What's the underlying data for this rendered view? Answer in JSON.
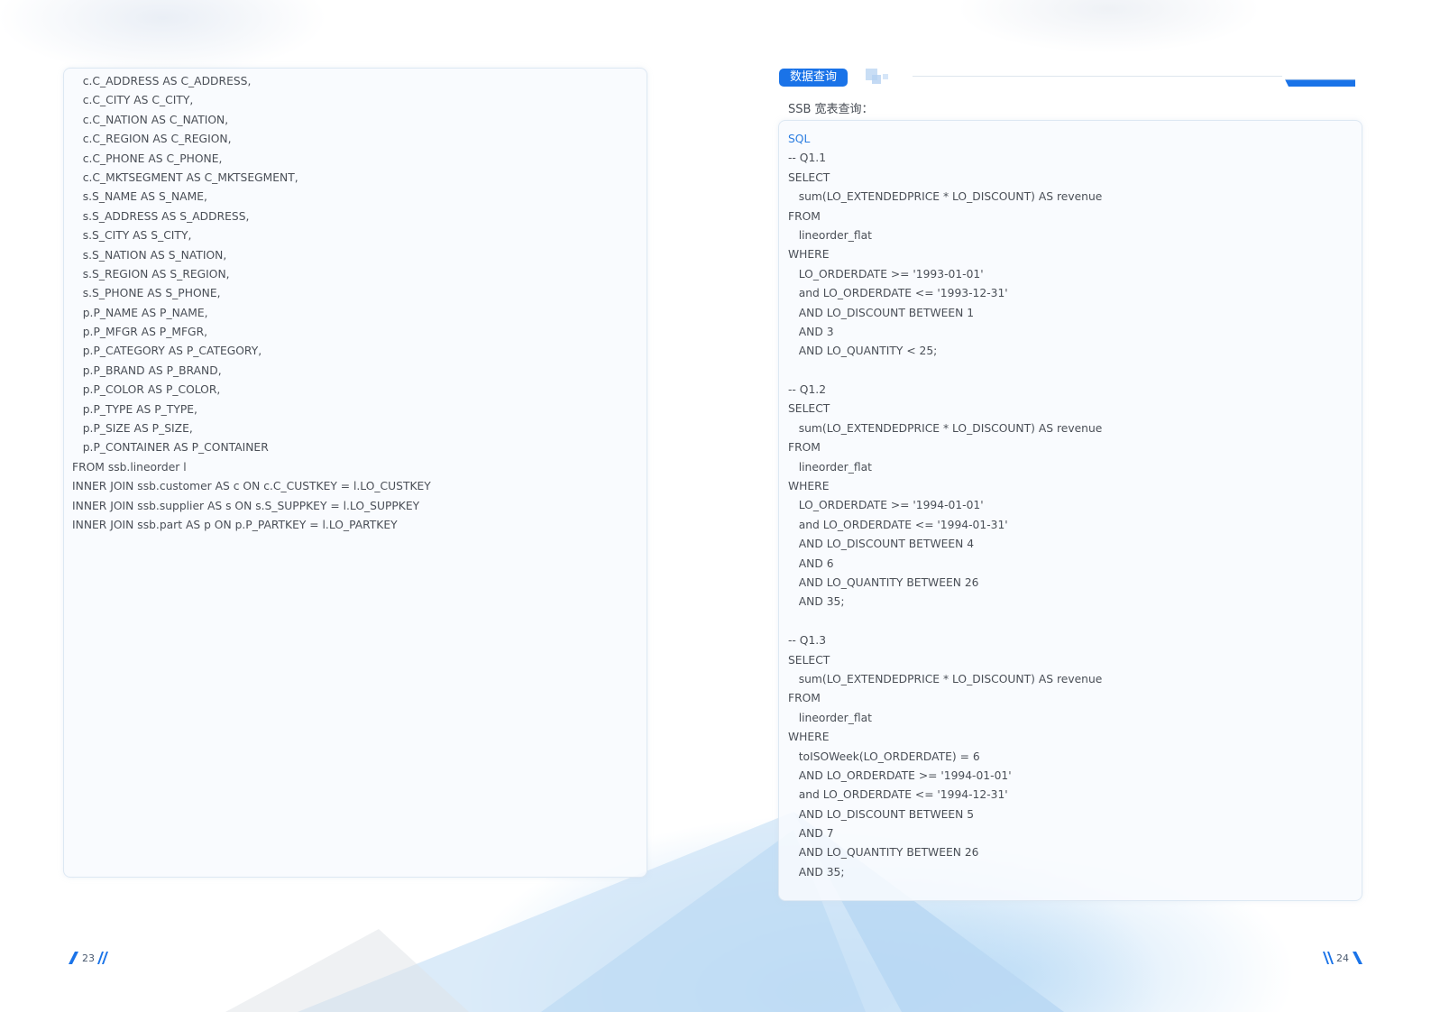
{
  "left_page": {
    "code_lines": [
      "   c.C_ADDRESS AS C_ADDRESS,",
      "   c.C_CITY AS C_CITY,",
      "   c.C_NATION AS C_NATION,",
      "   c.C_REGION AS C_REGION,",
      "   c.C_PHONE AS C_PHONE,",
      "   c.C_MKTSEGMENT AS C_MKTSEGMENT,",
      "   s.S_NAME AS S_NAME,",
      "   s.S_ADDRESS AS S_ADDRESS,",
      "   s.S_CITY AS S_CITY,",
      "   s.S_NATION AS S_NATION,",
      "   s.S_REGION AS S_REGION,",
      "   s.S_PHONE AS S_PHONE,",
      "   p.P_NAME AS P_NAME,",
      "   p.P_MFGR AS P_MFGR,",
      "   p.P_CATEGORY AS P_CATEGORY,",
      "   p.P_BRAND AS P_BRAND,",
      "   p.P_COLOR AS P_COLOR,",
      "   p.P_TYPE AS P_TYPE,",
      "   p.P_SIZE AS P_SIZE,",
      "   p.P_CONTAINER AS P_CONTAINER",
      "FROM ssb.lineorder l",
      "INNER JOIN ssb.customer AS c ON c.C_CUSTKEY = l.LO_CUSTKEY",
      "INNER JOIN ssb.supplier AS s ON s.S_SUPPKEY = l.LO_SUPPKEY",
      "INNER JOIN ssb.part AS p ON p.P_PARTKEY = l.LO_PARTKEY"
    ],
    "page_number": "23"
  },
  "right_page": {
    "section_tag": "数据查询",
    "sub_heading": "SSB 宽表查询：",
    "code_lines": [
      "SQL",
      "-- Q1.1",
      "SELECT",
      "   sum(LO_EXTENDEDPRICE * LO_DISCOUNT) AS revenue",
      "FROM",
      "   lineorder_flat",
      "WHERE",
      "   LO_ORDERDATE >= '1993-01-01'",
      "   and LO_ORDERDATE <= '1993-12-31'",
      "   AND LO_DISCOUNT BETWEEN 1",
      "   AND 3",
      "   AND LO_QUANTITY < 25;",
      "",
      "-- Q1.2",
      "SELECT",
      "   sum(LO_EXTENDEDPRICE * LO_DISCOUNT) AS revenue",
      "FROM",
      "   lineorder_flat",
      "WHERE",
      "   LO_ORDERDATE >= '1994-01-01'",
      "   and LO_ORDERDATE <= '1994-01-31'",
      "   AND LO_DISCOUNT BETWEEN 4",
      "   AND 6",
      "   AND LO_QUANTITY BETWEEN 26",
      "   AND 35;",
      "",
      "-- Q1.3",
      "SELECT",
      "   sum(LO_EXTENDEDPRICE * LO_DISCOUNT) AS revenue",
      "FROM",
      "   lineorder_flat",
      "WHERE",
      "   toISOWeek(LO_ORDERDATE) = 6",
      "   AND LO_ORDERDATE >= '1994-01-01'",
      "   and LO_ORDERDATE <= '1994-12-31'",
      "   AND LO_DISCOUNT BETWEEN 5",
      "   AND 7",
      "   AND LO_QUANTITY BETWEEN 26",
      "   AND 35;"
    ],
    "page_number": "24"
  },
  "colors": {
    "accent": "#1a73e8",
    "code_label": "#2b7de0",
    "text": "#4a4f57"
  }
}
